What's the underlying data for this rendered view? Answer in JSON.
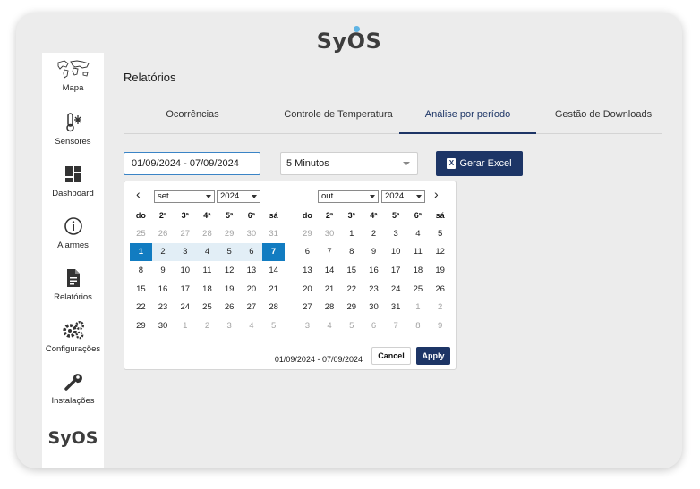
{
  "app": {
    "logo": "SyOS"
  },
  "sidebar": {
    "items": [
      {
        "label": "Mapa",
        "icon": "world-map-icon"
      },
      {
        "label": "Sensores",
        "icon": "thermometer-snowflake-icon"
      },
      {
        "label": "Dashboard",
        "icon": "dashboard-grid-icon"
      },
      {
        "label": "Alarmes",
        "icon": "info-circle-icon"
      },
      {
        "label": "Relatórios",
        "icon": "document-icon"
      },
      {
        "label": "Configurações",
        "icon": "gears-icon"
      },
      {
        "label": "Instalações",
        "icon": "wrench-icon"
      }
    ],
    "brand": "SyOS"
  },
  "page": {
    "title": "Relatórios",
    "tabs": [
      {
        "label": "Ocorrências",
        "active": false
      },
      {
        "label": "Controle de Temperatura",
        "active": false
      },
      {
        "label": "Análise por período",
        "active": true
      },
      {
        "label": "Gestão de Downloads",
        "active": false
      }
    ]
  },
  "filters": {
    "date_range_value": "01/09/2024 - 07/09/2024",
    "interval_value": "5 Minutos",
    "excel_button": "Gerar Excel"
  },
  "picker": {
    "weekdays": [
      "do",
      "2ª",
      "3ª",
      "4ª",
      "5ª",
      "6ª",
      "sá"
    ],
    "left": {
      "month": "set",
      "year": "2024",
      "weeks": [
        [
          [
            "25",
            "off"
          ],
          [
            "26",
            "off"
          ],
          [
            "27",
            "off"
          ],
          [
            "28",
            "off"
          ],
          [
            "29",
            "off"
          ],
          [
            "30",
            "off"
          ],
          [
            "31",
            "off"
          ]
        ],
        [
          [
            "1",
            "sel"
          ],
          [
            "2",
            "inrange"
          ],
          [
            "3",
            "inrange"
          ],
          [
            "4",
            "inrange"
          ],
          [
            "5",
            "inrange"
          ],
          [
            "6",
            "inrange"
          ],
          [
            "7",
            "sel"
          ]
        ],
        [
          [
            "8",
            ""
          ],
          [
            "9",
            ""
          ],
          [
            "10",
            ""
          ],
          [
            "11",
            ""
          ],
          [
            "12",
            ""
          ],
          [
            "13",
            ""
          ],
          [
            "14",
            ""
          ]
        ],
        [
          [
            "15",
            ""
          ],
          [
            "16",
            ""
          ],
          [
            "17",
            ""
          ],
          [
            "18",
            ""
          ],
          [
            "19",
            ""
          ],
          [
            "20",
            ""
          ],
          [
            "21",
            ""
          ]
        ],
        [
          [
            "22",
            ""
          ],
          [
            "23",
            ""
          ],
          [
            "24",
            ""
          ],
          [
            "25",
            ""
          ],
          [
            "26",
            ""
          ],
          [
            "27",
            ""
          ],
          [
            "28",
            ""
          ]
        ],
        [
          [
            "29",
            ""
          ],
          [
            "30",
            ""
          ],
          [
            "1",
            "off"
          ],
          [
            "2",
            "off"
          ],
          [
            "3",
            "off"
          ],
          [
            "4",
            "off"
          ],
          [
            "5",
            "off"
          ]
        ]
      ]
    },
    "right": {
      "month": "out",
      "year": "2024",
      "weeks": [
        [
          [
            "29",
            "off"
          ],
          [
            "30",
            "off"
          ],
          [
            "1",
            ""
          ],
          [
            "2",
            ""
          ],
          [
            "3",
            ""
          ],
          [
            "4",
            ""
          ],
          [
            "5",
            ""
          ]
        ],
        [
          [
            "6",
            ""
          ],
          [
            "7",
            ""
          ],
          [
            "8",
            ""
          ],
          [
            "9",
            ""
          ],
          [
            "10",
            ""
          ],
          [
            "11",
            ""
          ],
          [
            "12",
            ""
          ]
        ],
        [
          [
            "13",
            ""
          ],
          [
            "14",
            ""
          ],
          [
            "15",
            ""
          ],
          [
            "16",
            ""
          ],
          [
            "17",
            ""
          ],
          [
            "18",
            ""
          ],
          [
            "19",
            ""
          ]
        ],
        [
          [
            "20",
            ""
          ],
          [
            "21",
            ""
          ],
          [
            "22",
            ""
          ],
          [
            "23",
            ""
          ],
          [
            "24",
            ""
          ],
          [
            "25",
            ""
          ],
          [
            "26",
            ""
          ]
        ],
        [
          [
            "27",
            ""
          ],
          [
            "28",
            ""
          ],
          [
            "29",
            ""
          ],
          [
            "30",
            ""
          ],
          [
            "31",
            ""
          ],
          [
            "1",
            "off"
          ],
          [
            "2",
            "off"
          ]
        ],
        [
          [
            "3",
            "off"
          ],
          [
            "4",
            "off"
          ],
          [
            "5",
            "off"
          ],
          [
            "6",
            "off"
          ],
          [
            "7",
            "off"
          ],
          [
            "8",
            "off"
          ],
          [
            "9",
            "off"
          ]
        ]
      ]
    },
    "range_text": "01/09/2024 - 07/09/2024",
    "cancel_label": "Cancel",
    "apply_label": "Apply"
  },
  "colors": {
    "primary": "#1d3566",
    "selected_day": "#127cc1",
    "range_bg": "#e2eef6",
    "logo_accent": "#5fb4e4"
  }
}
